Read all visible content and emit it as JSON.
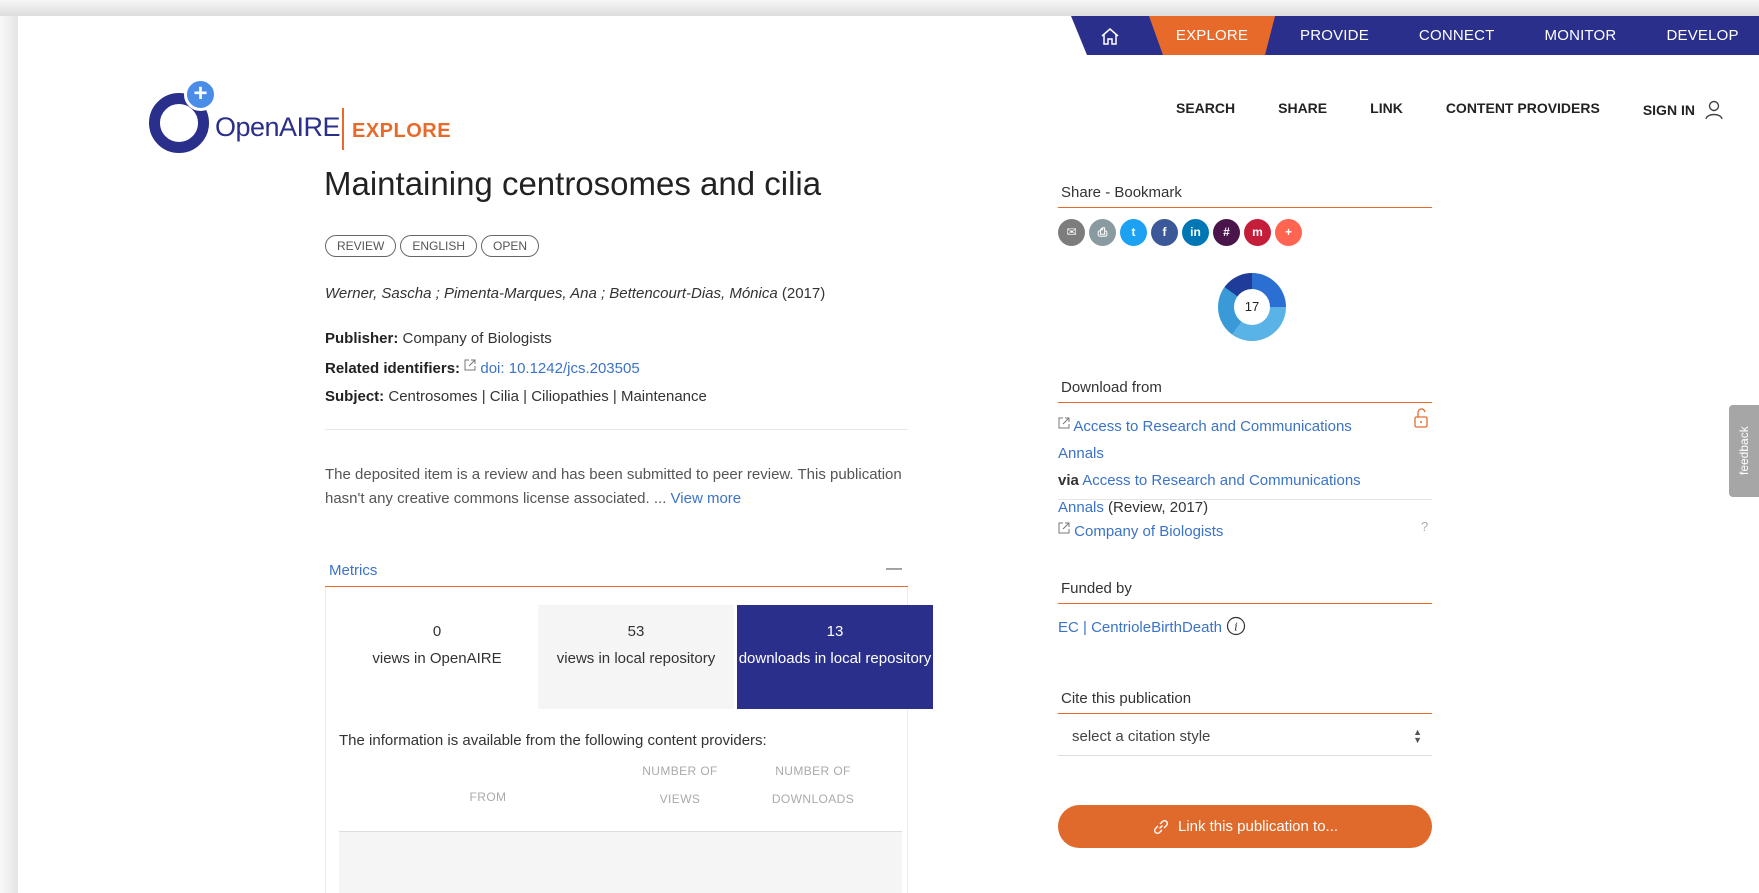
{
  "topnav": {
    "explore": "EXPLORE",
    "provide": "PROVIDE",
    "connect": "CONNECT",
    "monitor": "MONITOR",
    "develop": "DEVELOP"
  },
  "logo": {
    "open": "OpenAIRE",
    "explore": "EXPLORE"
  },
  "secnav": {
    "search": "SEARCH",
    "share": "SHARE",
    "link": "LINK",
    "content_providers": "CONTENT PROVIDERS",
    "sign_in": "SIGN IN"
  },
  "publication": {
    "title": "Maintaining centrosomes and cilia",
    "badges": [
      "REVIEW",
      "ENGLISH",
      "OPEN"
    ],
    "authors": "Werner, Sascha ; Pimenta-Marques, Ana ; Bettencourt-Dias, Mónica",
    "year": "(2017)",
    "publisher_label": "Publisher:",
    "publisher": "Company of Biologists",
    "related_label": "Related identifiers:",
    "related_doi": "doi: 10.1242/jcs.203505",
    "subject_label": "Subject:",
    "subjects": "Centrosomes | Cilia | Ciliopathies | Maintenance",
    "abstract": "The deposited item is a review and has been submitted to peer review. This publication hasn't any creative commons license associated. ...",
    "view_more": "View more"
  },
  "metrics": {
    "label": "Metrics",
    "collapse": "—",
    "cells": [
      {
        "value": "0",
        "label": "views in OpenAIRE"
      },
      {
        "value": "53",
        "label": "views in local repository"
      },
      {
        "value": "13",
        "label": "downloads in local repository"
      }
    ],
    "info": "The information is available from the following content providers:",
    "table_headers": {
      "from": "FROM",
      "views": "NUMBER OF VIEWS",
      "downloads": "NUMBER OF DOWNLOADS"
    }
  },
  "sidebar": {
    "share_title": "Share - Bookmark",
    "altmetric_score": "17",
    "download_title": "Download from",
    "download_link": "Access to Research and Communications Annals",
    "via_label": "via",
    "via_link": "Access to Research and Communications Annals",
    "via_suffix": "(Review, 2017)",
    "second_source": "Company of Biologists",
    "unknown_mark": "?",
    "funded_title": "Funded by",
    "funder": "EC | CentrioleBirthDeath",
    "cite_title": "Cite this publication",
    "cite_placeholder": "select a citation style",
    "link_button": "Link this publication to..."
  },
  "feedback": "feedback",
  "colors": {
    "brand_dark": "#2a2f8b",
    "brand_orange": "#e86a2b",
    "link": "#3b73c8"
  }
}
